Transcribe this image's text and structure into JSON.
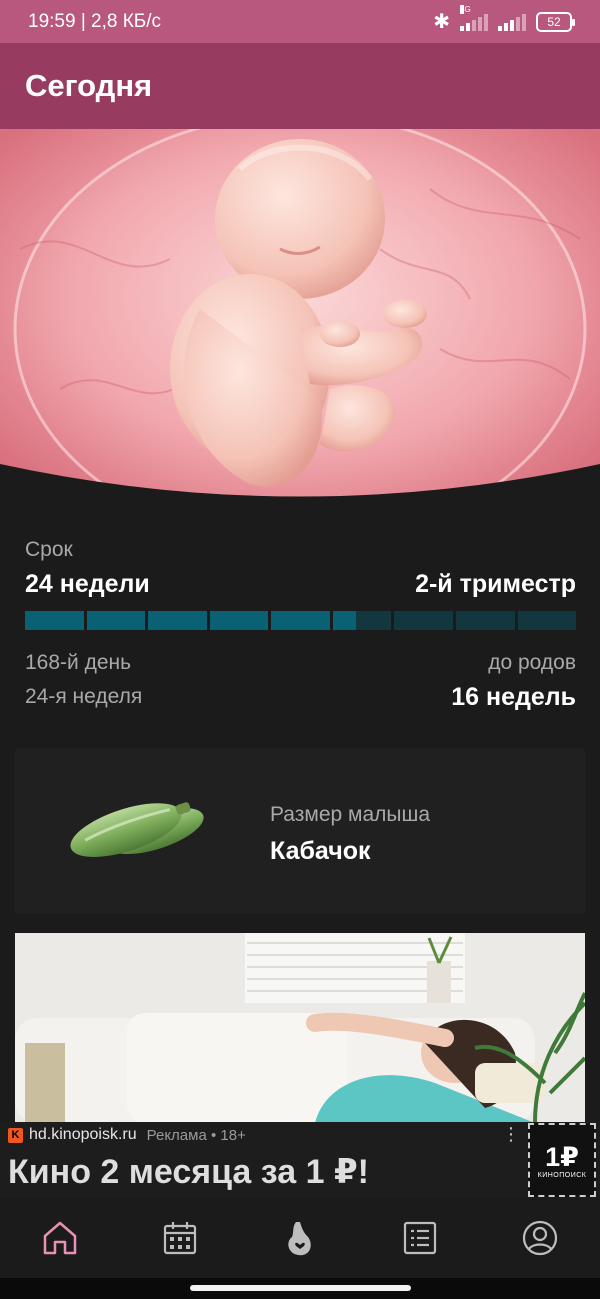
{
  "status_bar": {
    "time_speed": "19:59 | 2,8 КБ/с",
    "network": "4G",
    "battery": "52",
    "icons": [
      "bluetooth-icon",
      "signal-icon",
      "signal-icon",
      "battery-icon"
    ]
  },
  "app_bar": {
    "title": "Сегодня"
  },
  "hero": {
    "image": "fetus-illustration",
    "colors": {
      "primary": "#f2b1b6",
      "background": "#1b1b1b"
    }
  },
  "term": {
    "label": "Срок",
    "weeks": "24 недели",
    "trimester": "2-й триместр",
    "progress": {
      "segments_total": 9,
      "segments_filled": 5,
      "segment_partial_fraction": 0.4
    },
    "day": "168-й день",
    "week_number": "24-я неделя",
    "until_birth_label": "до родов",
    "until_birth_value": "16 недель"
  },
  "baby_size": {
    "label": "Размер малыша",
    "value": "Кабачок",
    "image": "zucchini-image"
  },
  "ad": {
    "image": "woman-on-sofa-photo",
    "domain": "hd.kinopoisk.ru",
    "label": "Реклама • 18+",
    "headline": "Кино 2 месяца за 1 ₽!",
    "logo_main": "1₽",
    "logo_sub": "КИНОПОИСК",
    "favicon": "K"
  },
  "bottom_nav": {
    "items": [
      {
        "name": "home",
        "icon": "home-icon",
        "active": true
      },
      {
        "name": "calendar",
        "icon": "calendar-icon",
        "active": false
      },
      {
        "name": "pregnancy",
        "icon": "pregnancy-icon",
        "active": false
      },
      {
        "name": "list",
        "icon": "list-icon",
        "active": false
      },
      {
        "name": "profile",
        "icon": "profile-icon",
        "active": false
      }
    ],
    "colors": {
      "active": "#e891b4",
      "inactive": "#bdbdbd"
    }
  }
}
